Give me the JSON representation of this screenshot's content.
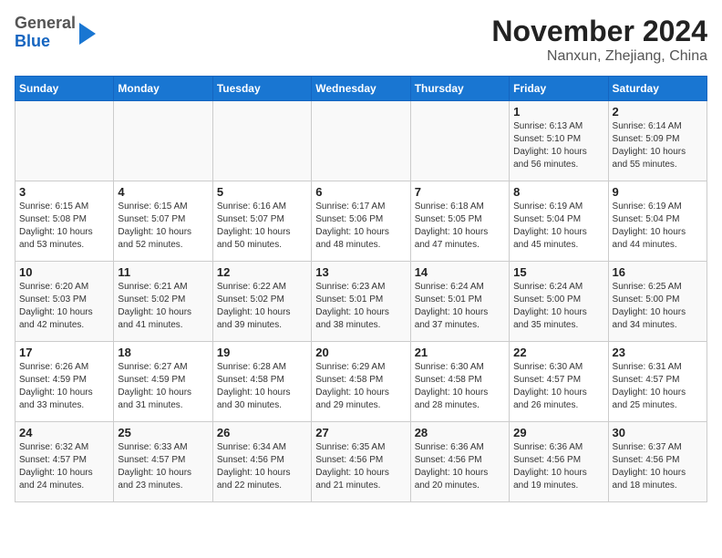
{
  "logo": {
    "line1": "General",
    "line2": "Blue"
  },
  "title": "November 2024",
  "location": "Nanxun, Zhejiang, China",
  "headers": [
    "Sunday",
    "Monday",
    "Tuesday",
    "Wednesday",
    "Thursday",
    "Friday",
    "Saturday"
  ],
  "weeks": [
    [
      {
        "day": "",
        "info": ""
      },
      {
        "day": "",
        "info": ""
      },
      {
        "day": "",
        "info": ""
      },
      {
        "day": "",
        "info": ""
      },
      {
        "day": "",
        "info": ""
      },
      {
        "day": "1",
        "info": "Sunrise: 6:13 AM\nSunset: 5:10 PM\nDaylight: 10 hours and 56 minutes."
      },
      {
        "day": "2",
        "info": "Sunrise: 6:14 AM\nSunset: 5:09 PM\nDaylight: 10 hours and 55 minutes."
      }
    ],
    [
      {
        "day": "3",
        "info": "Sunrise: 6:15 AM\nSunset: 5:08 PM\nDaylight: 10 hours and 53 minutes."
      },
      {
        "day": "4",
        "info": "Sunrise: 6:15 AM\nSunset: 5:07 PM\nDaylight: 10 hours and 52 minutes."
      },
      {
        "day": "5",
        "info": "Sunrise: 6:16 AM\nSunset: 5:07 PM\nDaylight: 10 hours and 50 minutes."
      },
      {
        "day": "6",
        "info": "Sunrise: 6:17 AM\nSunset: 5:06 PM\nDaylight: 10 hours and 48 minutes."
      },
      {
        "day": "7",
        "info": "Sunrise: 6:18 AM\nSunset: 5:05 PM\nDaylight: 10 hours and 47 minutes."
      },
      {
        "day": "8",
        "info": "Sunrise: 6:19 AM\nSunset: 5:04 PM\nDaylight: 10 hours and 45 minutes."
      },
      {
        "day": "9",
        "info": "Sunrise: 6:19 AM\nSunset: 5:04 PM\nDaylight: 10 hours and 44 minutes."
      }
    ],
    [
      {
        "day": "10",
        "info": "Sunrise: 6:20 AM\nSunset: 5:03 PM\nDaylight: 10 hours and 42 minutes."
      },
      {
        "day": "11",
        "info": "Sunrise: 6:21 AM\nSunset: 5:02 PM\nDaylight: 10 hours and 41 minutes."
      },
      {
        "day": "12",
        "info": "Sunrise: 6:22 AM\nSunset: 5:02 PM\nDaylight: 10 hours and 39 minutes."
      },
      {
        "day": "13",
        "info": "Sunrise: 6:23 AM\nSunset: 5:01 PM\nDaylight: 10 hours and 38 minutes."
      },
      {
        "day": "14",
        "info": "Sunrise: 6:24 AM\nSunset: 5:01 PM\nDaylight: 10 hours and 37 minutes."
      },
      {
        "day": "15",
        "info": "Sunrise: 6:24 AM\nSunset: 5:00 PM\nDaylight: 10 hours and 35 minutes."
      },
      {
        "day": "16",
        "info": "Sunrise: 6:25 AM\nSunset: 5:00 PM\nDaylight: 10 hours and 34 minutes."
      }
    ],
    [
      {
        "day": "17",
        "info": "Sunrise: 6:26 AM\nSunset: 4:59 PM\nDaylight: 10 hours and 33 minutes."
      },
      {
        "day": "18",
        "info": "Sunrise: 6:27 AM\nSunset: 4:59 PM\nDaylight: 10 hours and 31 minutes."
      },
      {
        "day": "19",
        "info": "Sunrise: 6:28 AM\nSunset: 4:58 PM\nDaylight: 10 hours and 30 minutes."
      },
      {
        "day": "20",
        "info": "Sunrise: 6:29 AM\nSunset: 4:58 PM\nDaylight: 10 hours and 29 minutes."
      },
      {
        "day": "21",
        "info": "Sunrise: 6:30 AM\nSunset: 4:58 PM\nDaylight: 10 hours and 28 minutes."
      },
      {
        "day": "22",
        "info": "Sunrise: 6:30 AM\nSunset: 4:57 PM\nDaylight: 10 hours and 26 minutes."
      },
      {
        "day": "23",
        "info": "Sunrise: 6:31 AM\nSunset: 4:57 PM\nDaylight: 10 hours and 25 minutes."
      }
    ],
    [
      {
        "day": "24",
        "info": "Sunrise: 6:32 AM\nSunset: 4:57 PM\nDaylight: 10 hours and 24 minutes."
      },
      {
        "day": "25",
        "info": "Sunrise: 6:33 AM\nSunset: 4:57 PM\nDaylight: 10 hours and 23 minutes."
      },
      {
        "day": "26",
        "info": "Sunrise: 6:34 AM\nSunset: 4:56 PM\nDaylight: 10 hours and 22 minutes."
      },
      {
        "day": "27",
        "info": "Sunrise: 6:35 AM\nSunset: 4:56 PM\nDaylight: 10 hours and 21 minutes."
      },
      {
        "day": "28",
        "info": "Sunrise: 6:36 AM\nSunset: 4:56 PM\nDaylight: 10 hours and 20 minutes."
      },
      {
        "day": "29",
        "info": "Sunrise: 6:36 AM\nSunset: 4:56 PM\nDaylight: 10 hours and 19 minutes."
      },
      {
        "day": "30",
        "info": "Sunrise: 6:37 AM\nSunset: 4:56 PM\nDaylight: 10 hours and 18 minutes."
      }
    ]
  ]
}
